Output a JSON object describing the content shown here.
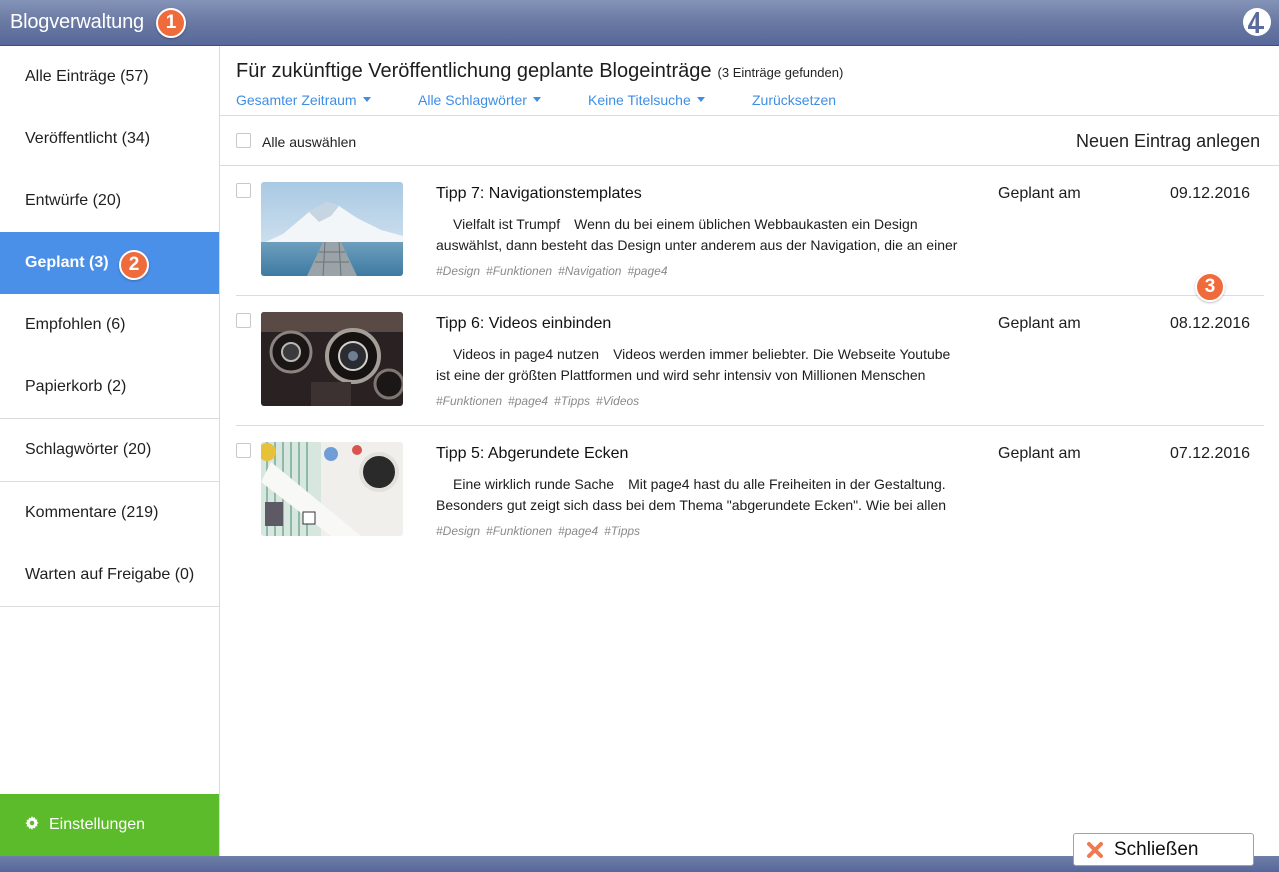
{
  "app": {
    "title": "Blogverwaltung",
    "callouts": [
      "1",
      "2",
      "3"
    ],
    "colors": {
      "accent_blue": "#4a8fe8",
      "link_blue": "#3f8ee4",
      "green": "#5cbb2a",
      "badge_orange": "#ef6b3b"
    }
  },
  "sidebar": {
    "items": [
      {
        "label": "Alle Einträge (57)"
      },
      {
        "label": "Veröffentlicht (34)"
      },
      {
        "label": "Entwürfe (20)"
      },
      {
        "label": "Geplant (3)",
        "active": true
      },
      {
        "label": "Empfohlen (6)"
      },
      {
        "label": "Papierkorb (2)"
      },
      {
        "label": "Schlagwörter (20)"
      },
      {
        "label": "Kommentare (219)"
      },
      {
        "label": "Warten auf Freigabe (0)"
      }
    ],
    "settings_label": "Einstellungen",
    "settings_icon": "gear-icon"
  },
  "main": {
    "title": "Für zukünftige Veröffentlichung geplante Blogeinträge",
    "count": "(3 Einträge gefunden)",
    "filters": {
      "time": "Gesamter Zeitraum",
      "tags": "Alle Schlagwörter",
      "title_search": "Keine Titelsuche",
      "reset": "Zurücksetzen"
    },
    "select_all": "Alle auswählen",
    "new_entry": "Neuen Eintrag anlegen",
    "entries": [
      {
        "title": "Tipp 7: Navigationstemplates",
        "excerpt_head": "Vielfalt ist Trumpf",
        "excerpt": "Wenn du bei einem üblichen Webbaukasten ein Design auswählst, dann besteht das Design unter anderem aus der Navigation, die an einer",
        "tags": [
          "#Design",
          "#Funktionen",
          "#Navigation",
          "#page4"
        ],
        "status": "Geplant am",
        "date": "09.12.2016"
      },
      {
        "title": "Tipp 6: Videos einbinden",
        "excerpt_head": "Videos in page4 nutzen",
        "excerpt": "Videos werden immer beliebter. Die Webseite Youtube ist eine der größten Plattformen und wird sehr intensiv von Millionen Menschen",
        "tags": [
          "#Funktionen",
          "#page4",
          "#Tipps",
          "#Videos"
        ],
        "status": "Geplant am",
        "date": "08.12.2016"
      },
      {
        "title": "Tipp 5: Abgerundete Ecken",
        "excerpt_head": "Eine wirklich runde Sache",
        "excerpt": "Mit page4 hast du alle Freiheiten in der Gestaltung. Besonders gut zeigt sich dass bei dem Thema \"abgerundete Ecken\". Wie bei allen",
        "tags": [
          "#Design",
          "#Funktionen",
          "#page4",
          "#Tipps"
        ],
        "status": "Geplant am",
        "date": "07.12.2016"
      }
    ]
  },
  "footer": {
    "close_label": "Schließen",
    "close_icon": "close-icon"
  }
}
